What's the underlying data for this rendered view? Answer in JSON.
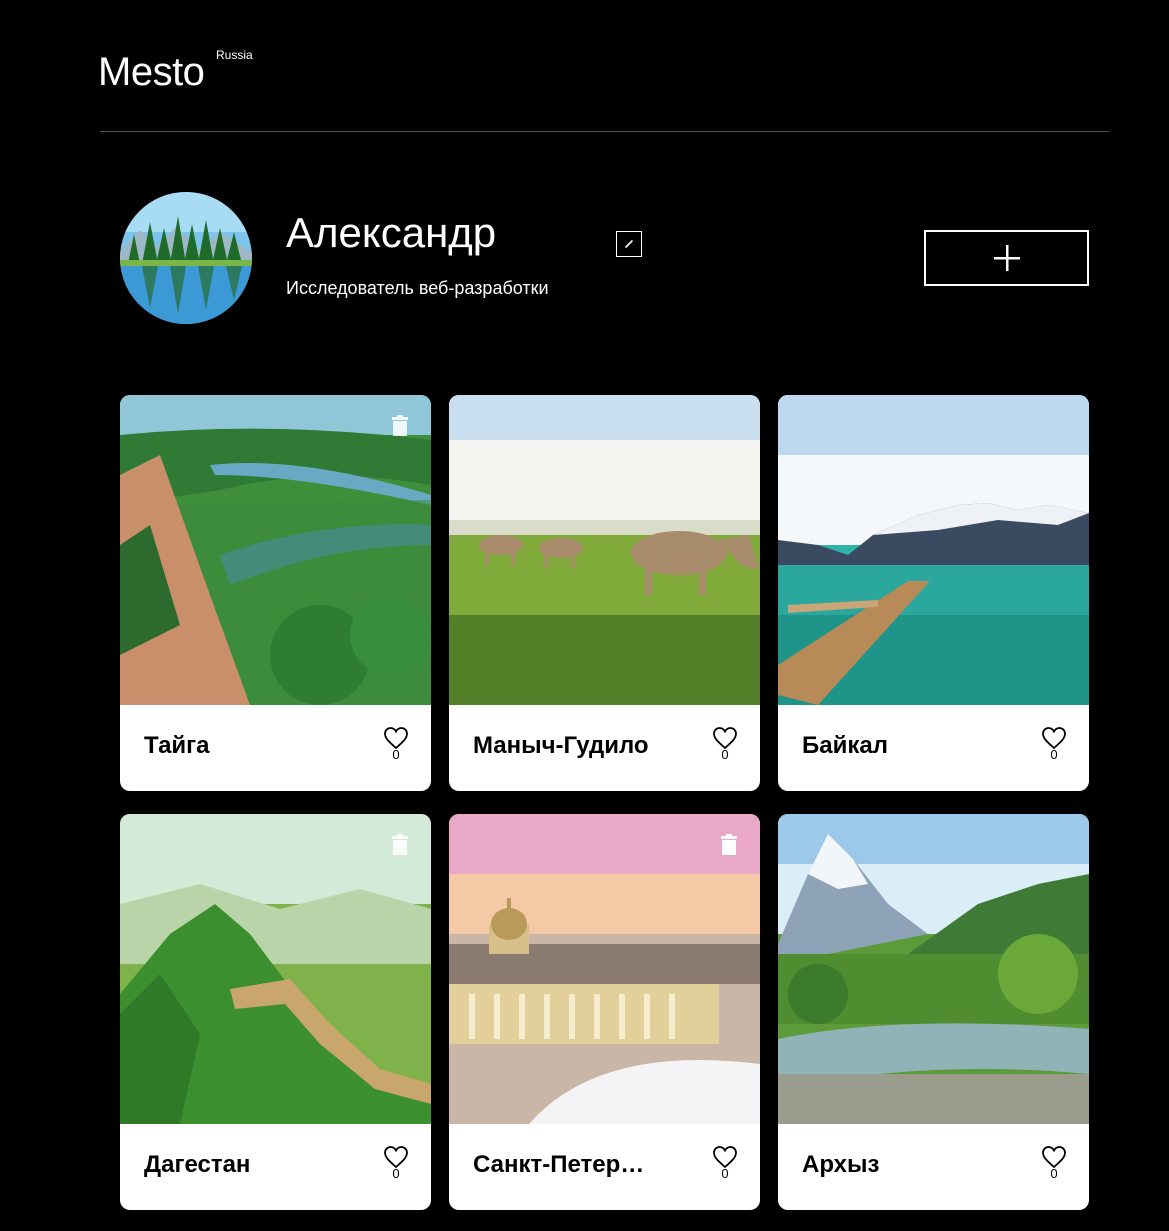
{
  "header": {
    "logo": "Mesto",
    "logo_sub": "Russia"
  },
  "profile": {
    "name": "Александр",
    "about": "Исследователь веб-разработки"
  },
  "cards": [
    {
      "title": "Тайга",
      "likes": "0",
      "deletable": true
    },
    {
      "title": "Маныч-Гудило",
      "likes": "0",
      "deletable": false
    },
    {
      "title": "Байкал",
      "likes": "0",
      "deletable": false
    },
    {
      "title": "Дагестан",
      "likes": "0",
      "deletable": true
    },
    {
      "title": "Санкт-Петер…",
      "likes": "0",
      "deletable": true
    },
    {
      "title": "Архыз",
      "likes": "0",
      "deletable": false
    }
  ],
  "colors": {
    "background": "#000000",
    "accent": "#ffffff",
    "divider": "#545454"
  }
}
